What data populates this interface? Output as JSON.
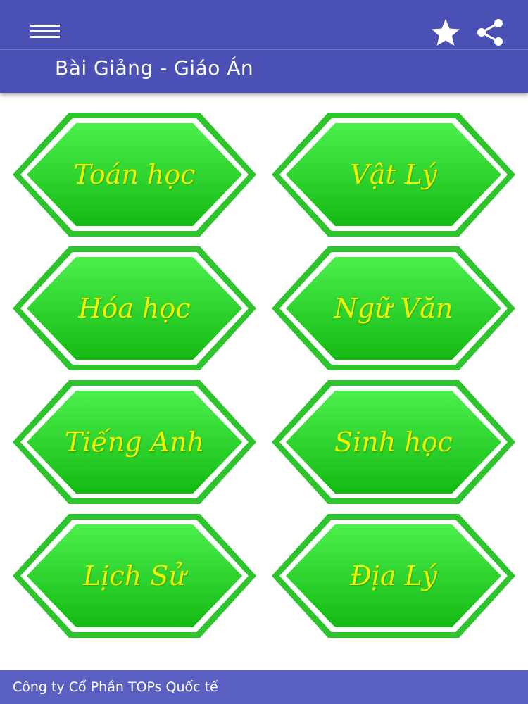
{
  "app": {
    "title": "Bài Giảng - Giáo Án",
    "bar_color": "#4b51b4"
  },
  "toolbar": {
    "menu_icon": "hamburger-menu-icon",
    "favorite_icon": "star-icon",
    "share_icon": "share-icon"
  },
  "subjects": [
    {
      "label": "Toán học"
    },
    {
      "label": "Vật Lý"
    },
    {
      "label": "Hóa học"
    },
    {
      "label": "Ngữ Văn"
    },
    {
      "label": "Tiếng Anh"
    },
    {
      "label": "Sinh học"
    },
    {
      "label": "Lịch Sử"
    },
    {
      "label": "Địa Lý"
    }
  ],
  "tile_colors": {
    "fill_top": "#4cf04c",
    "fill_bottom": "#14b914",
    "border": "#2ec42e",
    "text": "#f2f200"
  },
  "footer": {
    "company": "Công ty Cổ Phần TOPs Quốc tế"
  }
}
